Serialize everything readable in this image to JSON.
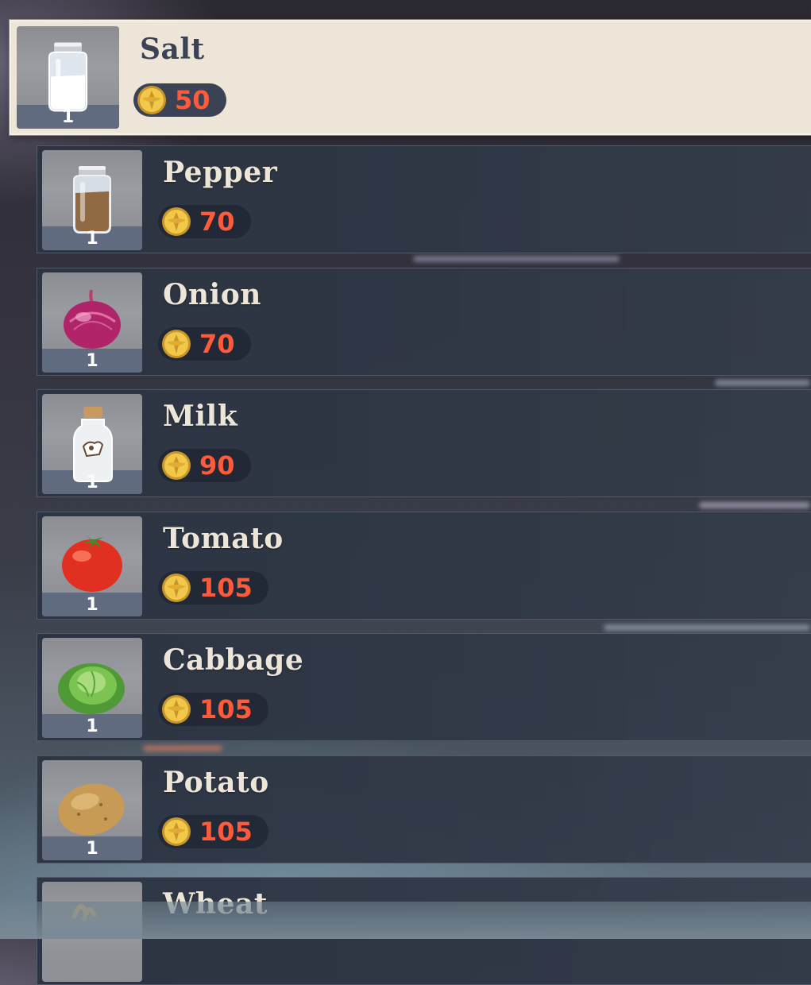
{
  "shop": {
    "items": [
      {
        "name": "Salt",
        "price": "50",
        "quantity": "1",
        "icon": "salt-shaker-icon",
        "selected": true
      },
      {
        "name": "Pepper",
        "price": "70",
        "quantity": "1",
        "icon": "pepper-shaker-icon",
        "selected": false
      },
      {
        "name": "Onion",
        "price": "70",
        "quantity": "1",
        "icon": "onion-icon",
        "selected": false
      },
      {
        "name": "Milk",
        "price": "90",
        "quantity": "1",
        "icon": "milk-bottle-icon",
        "selected": false
      },
      {
        "name": "Tomato",
        "price": "105",
        "quantity": "1",
        "icon": "tomato-icon",
        "selected": false
      },
      {
        "name": "Cabbage",
        "price": "105",
        "quantity": "1",
        "icon": "cabbage-icon",
        "selected": false
      },
      {
        "name": "Potato",
        "price": "105",
        "quantity": "1",
        "icon": "potato-icon",
        "selected": false
      },
      {
        "name": "Wheat",
        "price": "",
        "quantity": "",
        "icon": "wheat-icon",
        "selected": false
      }
    ],
    "currency_icon": "mora-coin-icon",
    "colors": {
      "selected_background": "#ece5d8",
      "row_background": "#2e3644",
      "price_text": "#ff5a3a",
      "name_text_selected": "#3b4255",
      "name_text": "#ece5d8"
    }
  }
}
